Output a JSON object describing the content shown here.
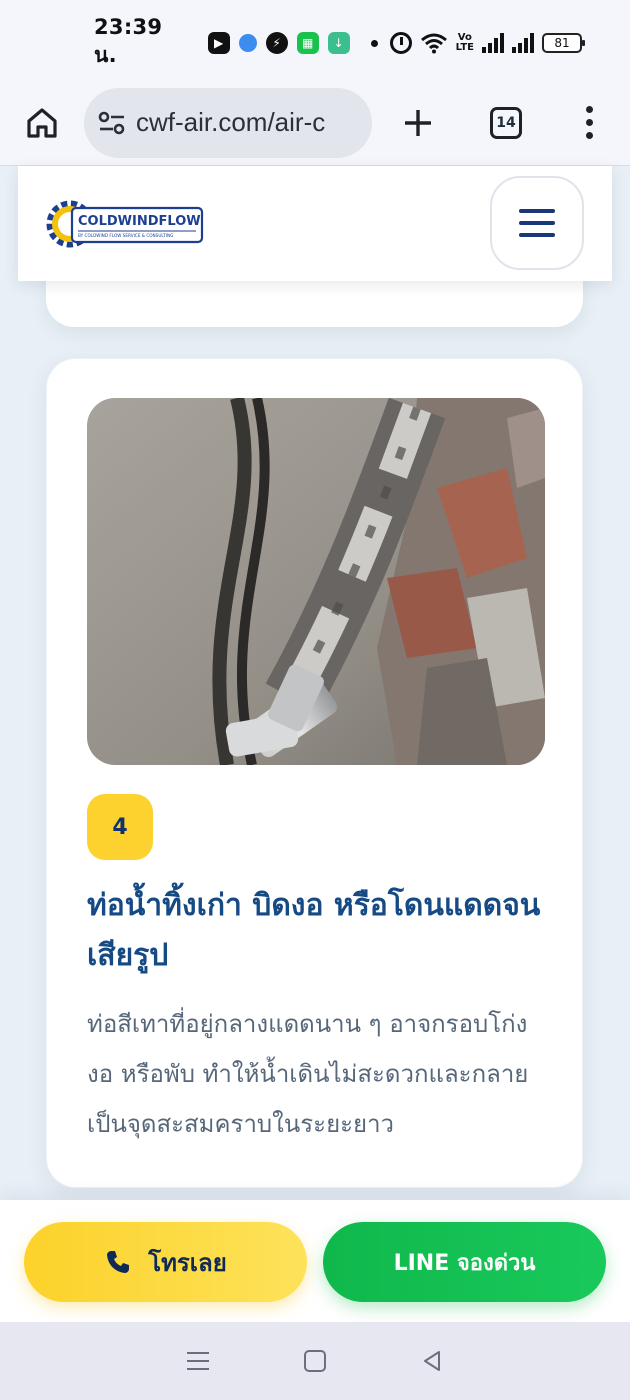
{
  "status_bar": {
    "time": "23:39 น.",
    "battery": "81",
    "volte_top": "Vo",
    "volte_bottom": "LTE"
  },
  "browser": {
    "url": "cwf-air.com/air-c",
    "tab_count": "14"
  },
  "site": {
    "logo_text": "COLDWINDFLOW",
    "logo_tagline": "BY COLDWIND FLOW SERVICE & CONSULTING"
  },
  "card": {
    "step_number": "4",
    "title": "ท่อน้ำทิ้งเก่า บิดงอ หรือโดนแดดจนเสียรูป",
    "description": "ท่อสีเทาที่อยู่กลางแดดนาน ๆ อาจกรอบโก่ง งอ หรือพับ ทำให้น้ำเดินไม่สะดวกและกลายเป็นจุดสะสมคราบในระยะยาว"
  },
  "cta": {
    "call_label": "โทรเลย",
    "line_label": "LINE จองด่วน"
  },
  "colors": {
    "accent_yellow": "#fdd22e",
    "accent_green": "#19c95b",
    "brand_navy": "#164a84"
  }
}
